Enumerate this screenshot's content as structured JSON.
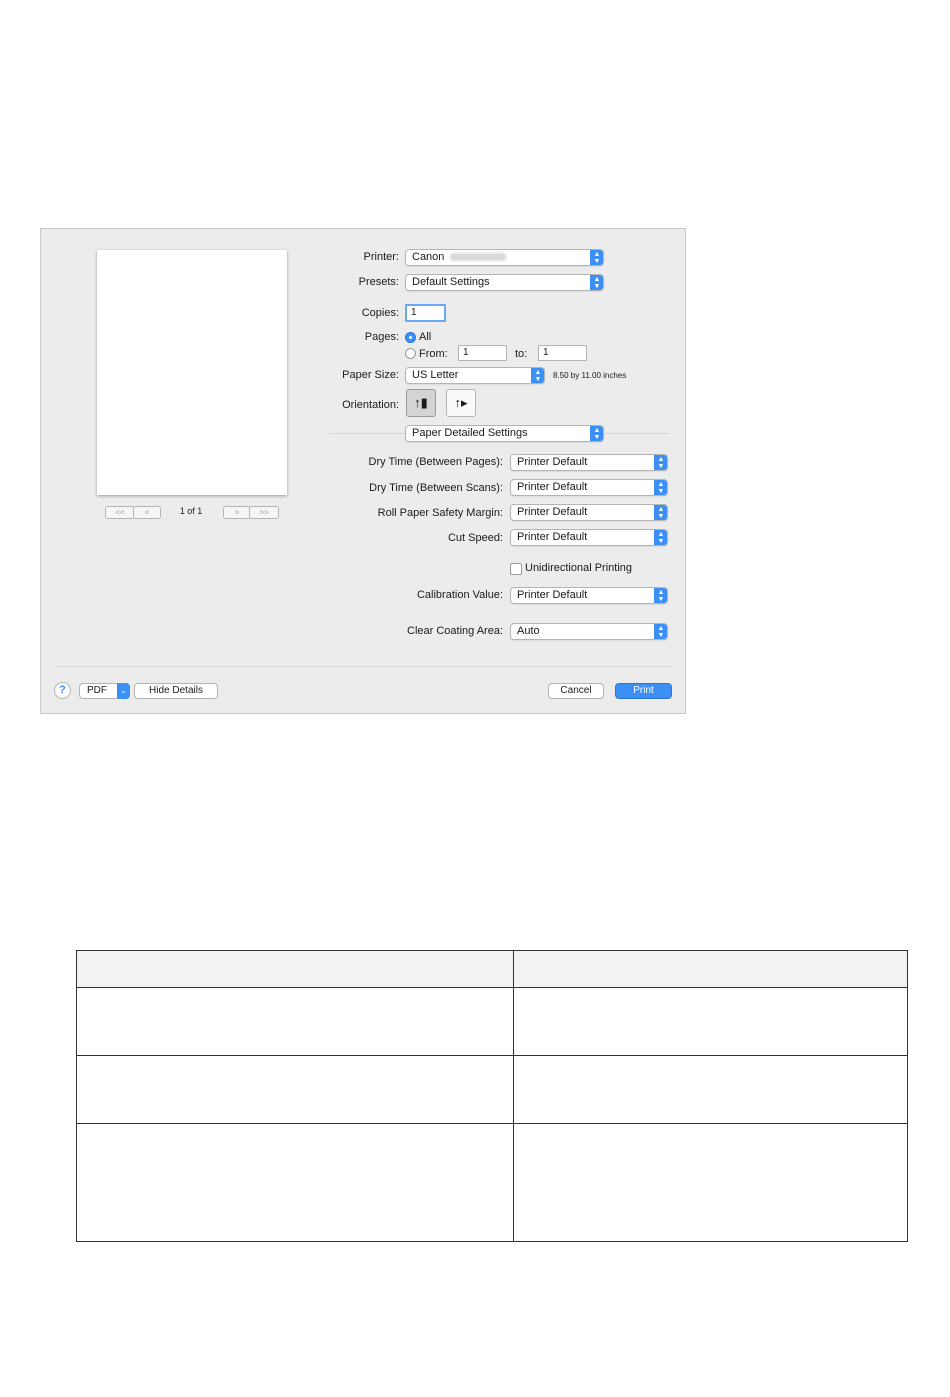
{
  "dialog": {
    "preview": {
      "page_indicator": "1 of 1",
      "nav_first": "<<",
      "nav_prev": "<",
      "nav_next": ">",
      "nav_last": ">>"
    },
    "printer": {
      "label": "Printer:",
      "value": "Canon"
    },
    "presets": {
      "label": "Presets:",
      "value": "Default Settings"
    },
    "copies": {
      "label": "Copies:",
      "value": "1"
    },
    "pages": {
      "label": "Pages:",
      "all_label": "All",
      "from_label": "From:",
      "from_value": "1",
      "to_label": "to:",
      "to_value": "1",
      "selected": "All"
    },
    "paper_size": {
      "label": "Paper Size:",
      "value": "US Letter",
      "dimensions": "8.50 by 11.00 inches"
    },
    "orientation": {
      "label": "Orientation:",
      "selected": "portrait"
    },
    "panel_selector": {
      "value": "Paper Detailed Settings"
    },
    "settings": [
      {
        "label": "Dry Time (Between Pages):",
        "value": "Printer Default"
      },
      {
        "label": "Dry Time (Between Scans):",
        "value": "Printer Default"
      },
      {
        "label": "Roll Paper Safety Margin:",
        "value": "Printer Default"
      },
      {
        "label": "Cut Speed:",
        "value": "Printer Default"
      }
    ],
    "unidirectional": {
      "label": "Unidirectional Printing",
      "checked": false
    },
    "calibration": {
      "label": "Calibration Value:",
      "value": "Printer Default"
    },
    "clear_coating": {
      "label": "Clear Coating Area:",
      "value": "Auto"
    },
    "footer": {
      "help": "?",
      "pdf": "PDF",
      "hide_details": "Hide Details",
      "cancel": "Cancel",
      "print": "Print"
    }
  },
  "colors": {
    "accent": "#3c8ff5",
    "dialog_bg": "#ececec"
  }
}
